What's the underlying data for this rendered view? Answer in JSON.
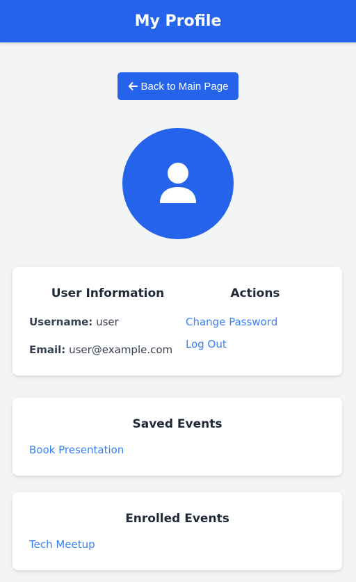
{
  "header": {
    "title": "My Profile"
  },
  "back_button": {
    "label": "Back to Main Page",
    "icon": "arrow-left-icon"
  },
  "avatar": {
    "icon": "user-icon"
  },
  "user_info": {
    "title": "User Information",
    "username_label": "Username:",
    "username_value": "user",
    "email_label": "Email:",
    "email_value": "user@example.com"
  },
  "actions": {
    "title": "Actions",
    "change_password": "Change Password",
    "log_out": "Log Out"
  },
  "saved_events": {
    "title": "Saved Events",
    "items": [
      "Book Presentation"
    ]
  },
  "enrolled_events": {
    "title": "Enrolled Events",
    "items": [
      "Tech Meetup"
    ]
  },
  "colors": {
    "primary": "#2563eb",
    "link": "#3b82f6",
    "background": "#f3f4f6",
    "card": "#ffffff"
  }
}
